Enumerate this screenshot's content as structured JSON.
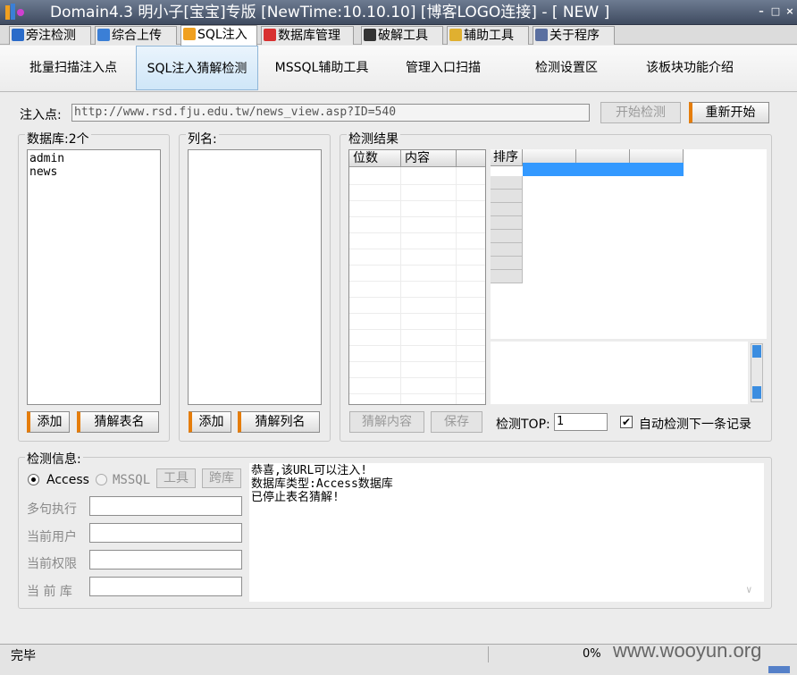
{
  "titlebar": {
    "title": "Domain4.3 明小子[宝宝]专版 [NewTime:10.10.10] [博客LOGO连接]  - [ NEW ]",
    "minimize": "–",
    "maximize": "□",
    "close": "×"
  },
  "top_tabs": [
    {
      "label": "旁注检测",
      "icon": "magnifier-icon"
    },
    {
      "label": "综合上传",
      "icon": "chart-icon"
    },
    {
      "label": "SQL注入",
      "icon": "search-doc-icon"
    },
    {
      "label": "数据库管理",
      "icon": "database-icon"
    },
    {
      "label": "破解工具",
      "icon": "keyboard-icon"
    },
    {
      "label": "辅助工具",
      "icon": "clipboard-icon"
    },
    {
      "label": "关于程序",
      "icon": "book-icon"
    }
  ],
  "sub_tabs": [
    "批量扫描注入点",
    "SQL注入猜解检测",
    "MSSQL辅助工具",
    "管理入口扫描",
    "检测设置区",
    "该板块功能介绍"
  ],
  "inject": {
    "label": "注入点:",
    "url": "http://www.rsd.fju.edu.tw/news_view.asp?ID=540",
    "start_button": "开始检测",
    "restart_button": "重新开始"
  },
  "database": {
    "label": "数据库:2个",
    "items": [
      "admin",
      "news"
    ],
    "add_button": "添加",
    "guess_button": "猜解表名"
  },
  "columns": {
    "label": "列名:",
    "add_button": "添加",
    "guess_button": "猜解列名"
  },
  "results": {
    "label": "检测结果",
    "grid_headers": [
      "位数",
      "内容"
    ],
    "sort_header": "排序",
    "guess_content_button": "猜解内容",
    "save_button": "保存",
    "top_label": "检测TOP:",
    "top_value": "1",
    "auto_label": "自动检测下一条记录",
    "auto_checked": true
  },
  "info": {
    "label": "检测信息:",
    "radio_access": "Access",
    "radio_mssql": "MSSQL",
    "tool_button": "工具",
    "crossdb_button": "跨库",
    "fields": [
      "多句执行",
      "当前用户",
      "当前权限",
      "当 前 库"
    ],
    "log_lines": [
      "恭喜,该URL可以注入!",
      "数据库类型:Access数据库",
      "已停止表名猜解!"
    ]
  },
  "status": {
    "text": "完毕",
    "progress": "0%",
    "watermark": "www.wooyun.org"
  },
  "colors": {
    "accent": "#e57d0b",
    "selection": "#3399ff",
    "titlebar": "#4a566b"
  }
}
